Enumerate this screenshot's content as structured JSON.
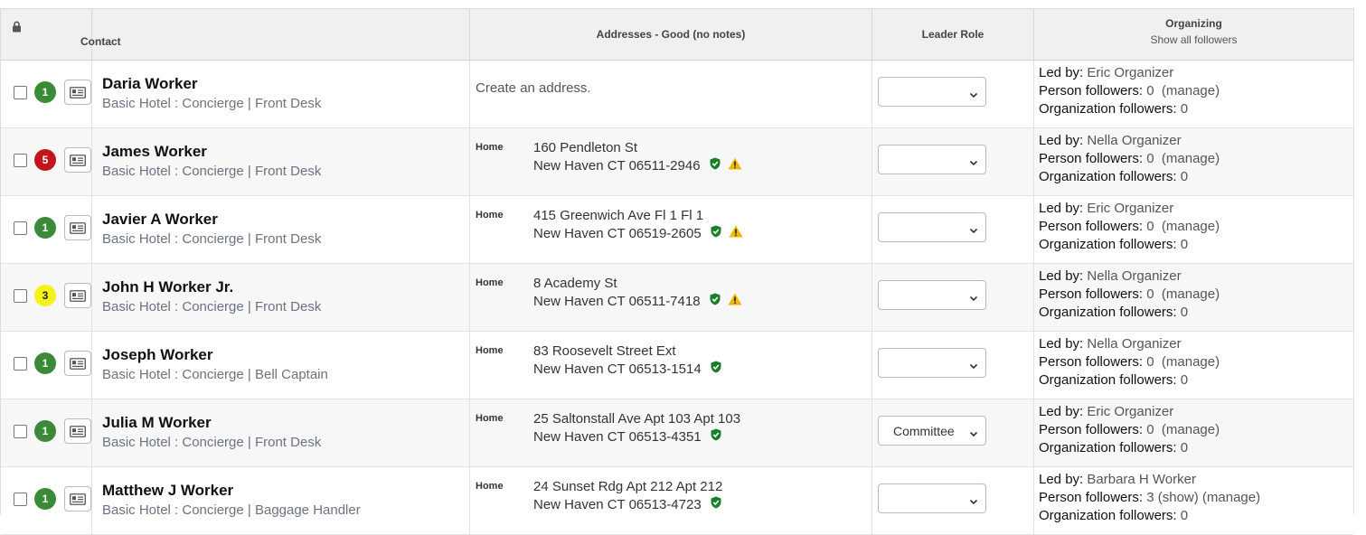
{
  "header": {
    "contact": "Contact",
    "addresses": "Addresses - Good (no notes)",
    "leader_role": "Leader Role",
    "organizing": "Organizing",
    "show_all_followers": "Show all followers"
  },
  "labels": {
    "led_by": "Led by:",
    "person_followers": "Person followers:",
    "organization_followers": "Organization followers:",
    "create_address": "Create an address.",
    "home": "Home"
  },
  "colors": {
    "green": "#3a8a3a",
    "red": "#c0161c",
    "yellow": "#f3f21a",
    "shield": "#1a7f2a",
    "warning": "#f2b705"
  },
  "rows": [
    {
      "badge": "1",
      "badge_color": "green",
      "name": "Daria Worker",
      "subtitle": "Basic Hotel : Concierge | Front Desk",
      "address": null,
      "role": "",
      "led_by": "Eric Organizer",
      "person_followers": "0  (manage)",
      "org_followers": "0"
    },
    {
      "badge": "5",
      "badge_color": "red",
      "name": "James Worker",
      "subtitle": "Basic Hotel : Concierge | Front Desk",
      "address": {
        "line1": "160 Pendleton St",
        "line2": "New Haven CT 06511-2946",
        "warning": true
      },
      "role": "",
      "led_by": "Nella Organizer",
      "person_followers": "0  (manage)",
      "org_followers": "0"
    },
    {
      "badge": "1",
      "badge_color": "green",
      "name": "Javier A Worker",
      "subtitle": "Basic Hotel : Concierge | Front Desk",
      "address": {
        "line1": "415 Greenwich Ave Fl 1 Fl 1",
        "line2": "New Haven CT 06519-2605",
        "warning": true
      },
      "role": "",
      "led_by": "Eric Organizer",
      "person_followers": "0  (manage)",
      "org_followers": "0"
    },
    {
      "badge": "3",
      "badge_color": "yellow",
      "name": "John H Worker Jr.",
      "subtitle": "Basic Hotel : Concierge | Front Desk",
      "address": {
        "line1": "8 Academy St",
        "line2": "New Haven CT 06511-7418",
        "warning": true
      },
      "role": "",
      "led_by": "Nella Organizer",
      "person_followers": "0  (manage)",
      "org_followers": "0"
    },
    {
      "badge": "1",
      "badge_color": "green",
      "name": "Joseph Worker",
      "subtitle": "Basic Hotel : Concierge | Bell Captain",
      "address": {
        "line1": "83 Roosevelt Street Ext",
        "line2": "New Haven CT 06513-1514",
        "warning": false
      },
      "role": "",
      "led_by": "Nella Organizer",
      "person_followers": "0  (manage)",
      "org_followers": "0"
    },
    {
      "badge": "1",
      "badge_color": "green",
      "name": "Julia M Worker",
      "subtitle": "Basic Hotel : Concierge | Front Desk",
      "address": {
        "line1": "25 Saltonstall Ave Apt 103 Apt 103",
        "line2": "New Haven CT 06513-4351",
        "warning": false
      },
      "role": "Committee",
      "led_by": "Eric Organizer",
      "person_followers": "0  (manage)",
      "org_followers": "0"
    },
    {
      "badge": "1",
      "badge_color": "green",
      "name": "Matthew J Worker",
      "subtitle": "Basic Hotel : Concierge | Baggage Handler",
      "address": {
        "line1": "24 Sunset Rdg Apt 212 Apt 212",
        "line2": "New Haven CT 06513-4723",
        "warning": false
      },
      "role": "",
      "led_by": "Barbara H Worker",
      "person_followers": "3 (show) (manage)",
      "org_followers": "0"
    }
  ]
}
